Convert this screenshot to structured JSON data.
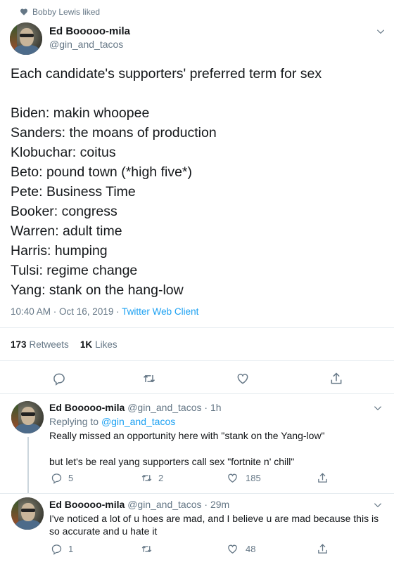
{
  "social_context": "Bobby Lewis liked",
  "main_tweet": {
    "name": "Ed Booooo-mila",
    "handle": "@gin_and_tacos",
    "headline": "Each candidate's supporters' preferred term for sex",
    "lines": [
      "Biden: makin whoopee",
      "Sanders: the moans of production",
      "Klobuchar: coitus",
      "Beto: pound town (*high five*)",
      "Pete: Business Time",
      "Booker: congress",
      "Warren: adult time",
      "Harris: humping",
      "Tulsi: regime change",
      "Yang: stank on the hang-low"
    ],
    "time": "10:40 AM · Oct 16, 2019 · ",
    "client": "Twitter Web Client",
    "retweets_count": "173",
    "retweets_label": "Retweets",
    "likes_count": "1K",
    "likes_label": "Likes"
  },
  "replies": [
    {
      "name": "Ed Booooo-mila",
      "meta": "@gin_and_tacos · 1h",
      "replying_prefix": "Replying to ",
      "replying_to": "@gin_and_tacos",
      "text_1": "Really missed an opportunity here with \"stank on the Yang-low\"",
      "text_2": "but let's be real yang supporters call sex \"fortnite n' chill\"",
      "reply_count": "5",
      "retweet_count": "2",
      "like_count": "185"
    },
    {
      "name": "Ed Booooo-mila",
      "meta": "@gin_and_tacos · 29m",
      "text_1": "I've noticed a lot of u hoes are mad, and I believe u are mad because this is so accurate and u hate it",
      "reply_count": "1",
      "retweet_count": "",
      "like_count": "48"
    }
  ],
  "colors": {
    "link": "#1da1f2",
    "secondary": "#657786",
    "text": "#14171a",
    "divider": "#e6ecf0"
  }
}
